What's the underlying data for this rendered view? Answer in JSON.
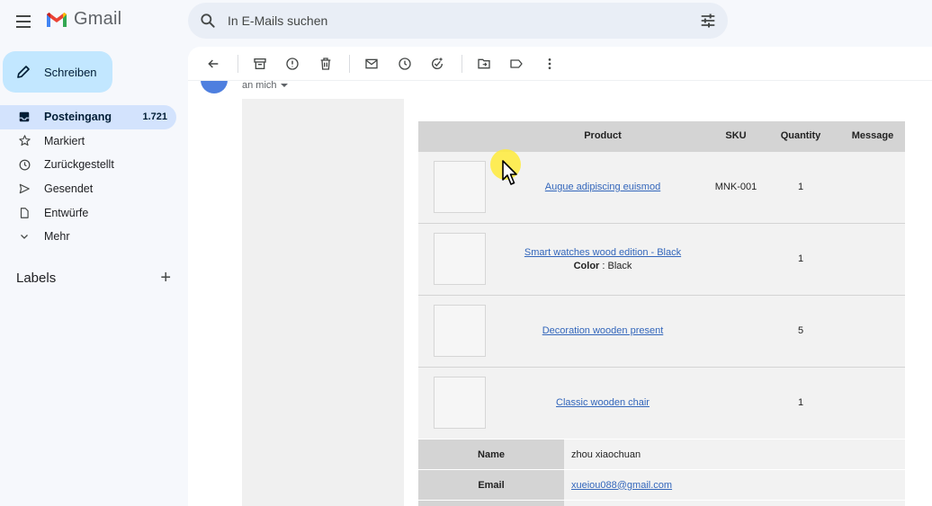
{
  "app": {
    "brand": "Gmail"
  },
  "search": {
    "placeholder": "In E-Mails suchen"
  },
  "compose": {
    "label": "Schreiben"
  },
  "sidebar": {
    "items": [
      {
        "label": "Posteingang",
        "count": "1.721",
        "icon": "inbox-icon"
      },
      {
        "label": "Markiert",
        "icon": "star-icon"
      },
      {
        "label": "Zurückgestellt",
        "icon": "clock-icon"
      },
      {
        "label": "Gesendet",
        "icon": "send-icon"
      },
      {
        "label": "Entwürfe",
        "icon": "draft-icon"
      },
      {
        "label": "Mehr",
        "icon": "chevron-down-icon"
      }
    ],
    "labels_title": "Labels"
  },
  "message": {
    "recipient": "an mich"
  },
  "products": {
    "headers": [
      "Product",
      "SKU",
      "Quantity",
      "Message"
    ],
    "rows": [
      {
        "name": "Augue adipiscing euismod",
        "sku": "MNK-001",
        "qty": "1",
        "message": ""
      },
      {
        "name": "Smart watches wood edition - Black",
        "color_label": "Color",
        "color_value": " : Black",
        "sku": "",
        "qty": "1",
        "message": ""
      },
      {
        "name": "Decoration wooden present",
        "sku": "",
        "qty": "5",
        "message": ""
      },
      {
        "name": "Classic wooden chair",
        "sku": "",
        "qty": "1",
        "message": ""
      }
    ]
  },
  "customer": {
    "name_label": "Name",
    "name_value": "zhou xiaochuan",
    "email_label": "Email",
    "email_value": "xueiou088@gmail.com"
  },
  "colors": {
    "accent": "#c2e7ff",
    "active_nav": "#d3e3fd",
    "link": "#3366bb"
  }
}
